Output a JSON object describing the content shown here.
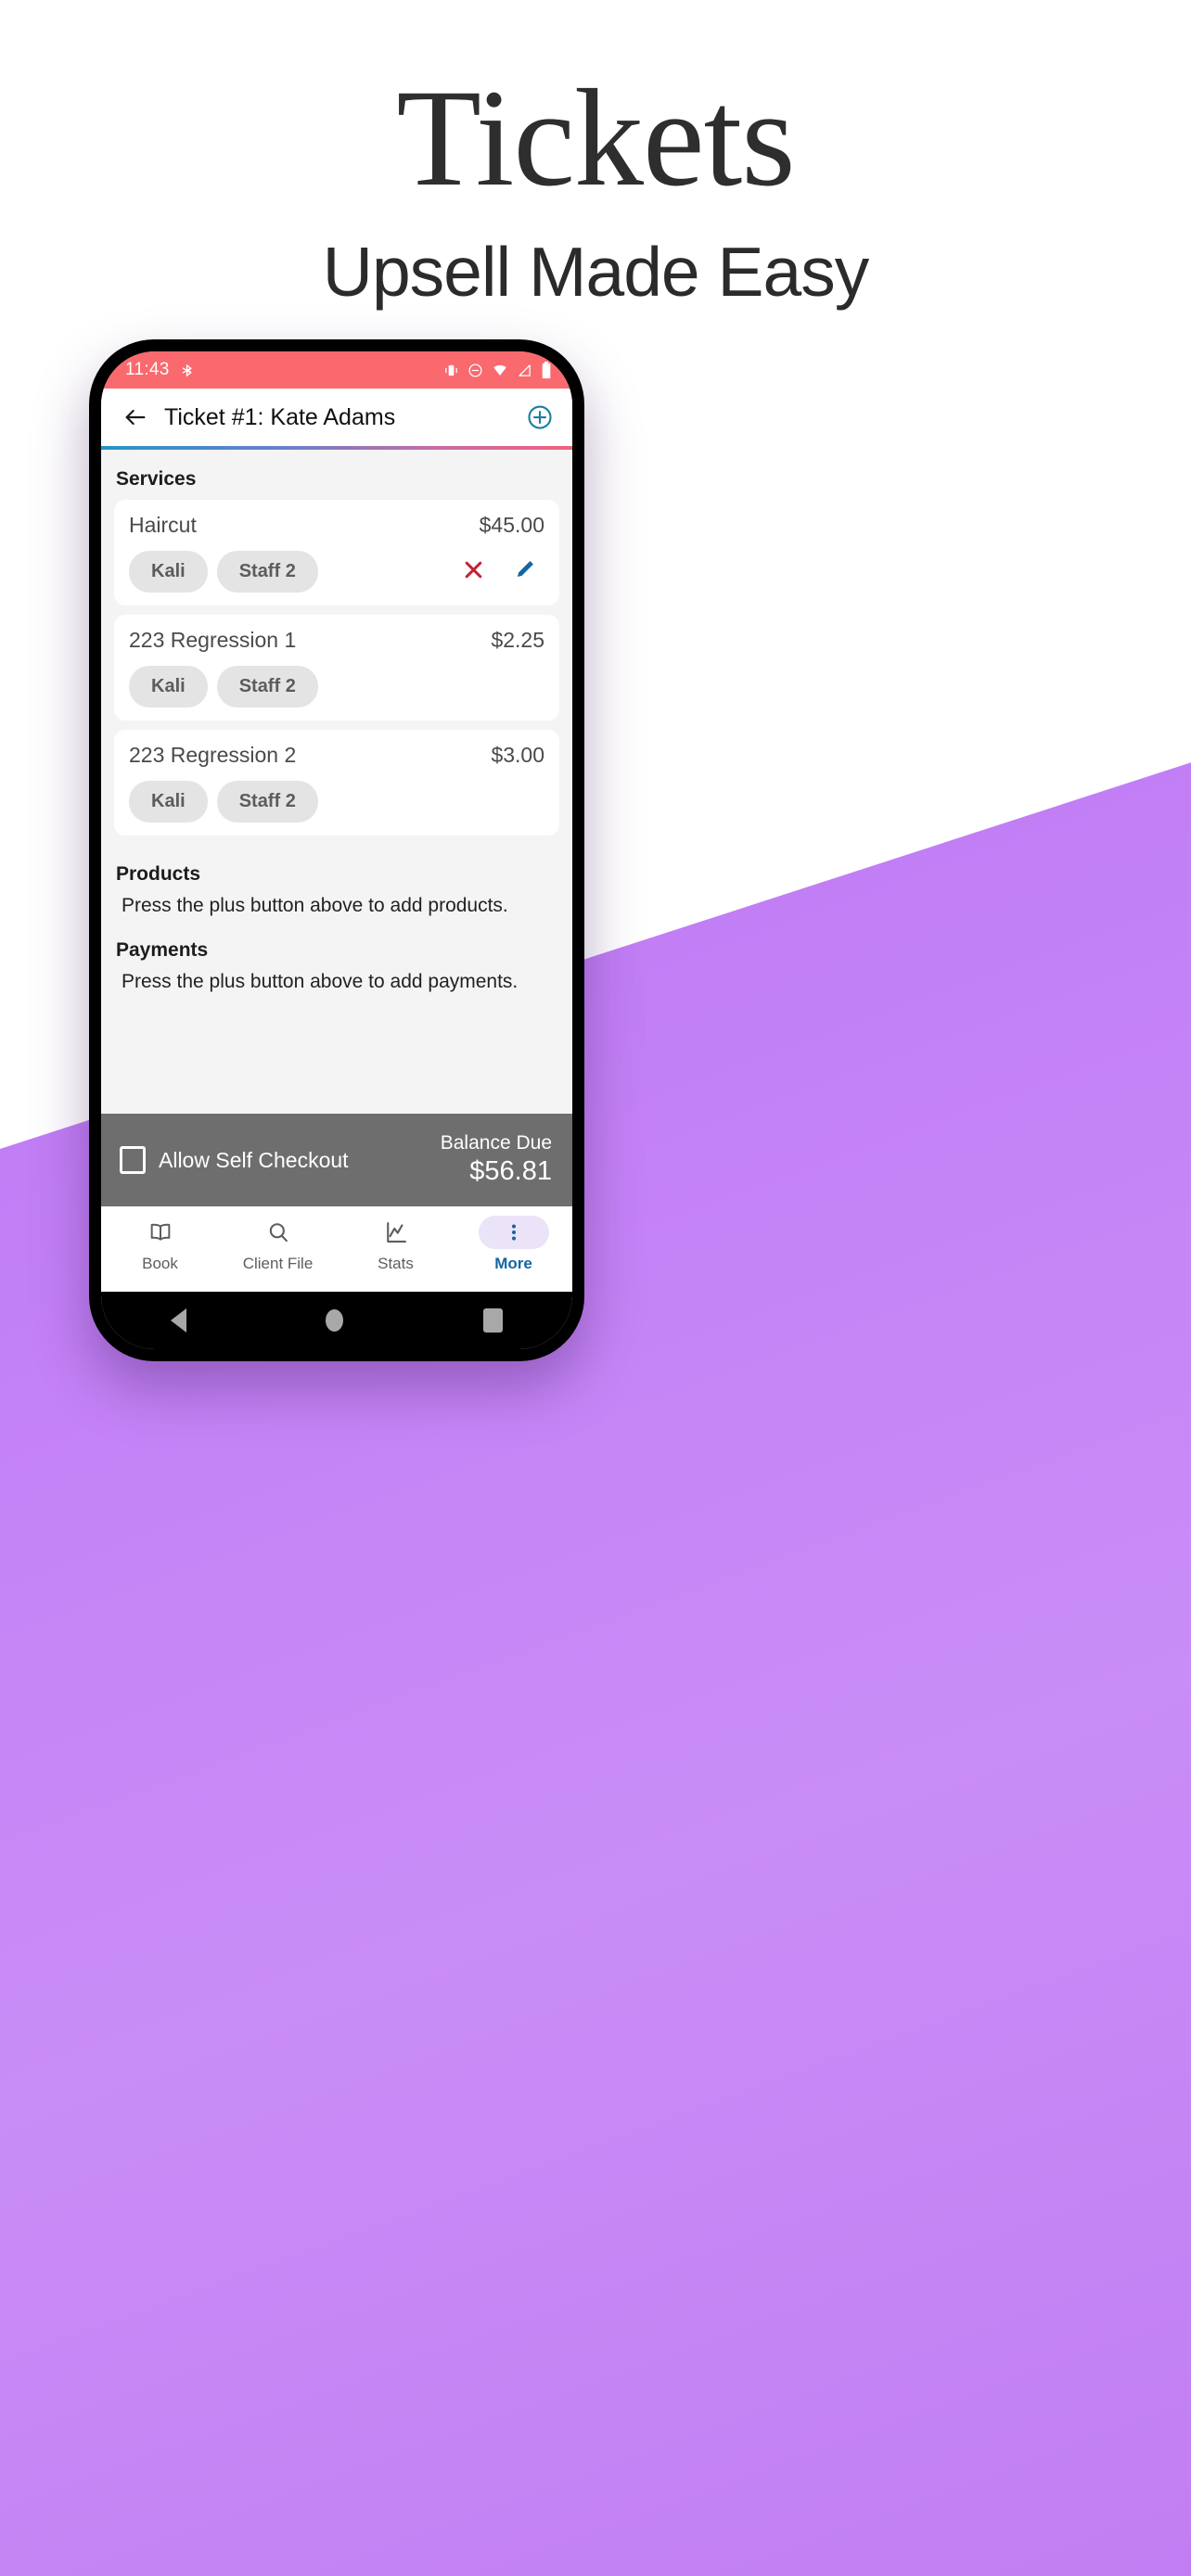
{
  "hero": {
    "title": "Tickets",
    "subtitle": "Upsell Made Easy"
  },
  "colors": {
    "purple_background": "#c07cf5",
    "status_bar": "#f9696e",
    "accent_teal": "#1a7fa0",
    "delete_red": "#c32033",
    "edit_blue": "#1565a0",
    "balance_bar": "#6e6e6e",
    "nav_active_pill": "#ebe3f7"
  },
  "phone": {
    "status_bar": {
      "time": "11:43",
      "left_icons": [
        "bluetooth-icon"
      ],
      "right_icons": [
        "vibrate-icon",
        "do-not-disturb-icon",
        "wifi-icon",
        "signal-icon",
        "battery-icon"
      ]
    },
    "app_bar": {
      "back_icon": "back-arrow-icon",
      "title": "Ticket #1: Kate Adams",
      "add_icon": "add-circle-icon"
    },
    "services": {
      "heading": "Services",
      "items": [
        {
          "name": "Haircut",
          "price": "$45.00",
          "staff": [
            "Kali",
            "Staff 2"
          ],
          "actions": [
            "delete-icon",
            "edit-icon"
          ]
        },
        {
          "name": "223 Regression 1",
          "price": "$2.25",
          "staff": [
            "Kali",
            "Staff 2"
          ],
          "actions": []
        },
        {
          "name": "223 Regression 2",
          "price": "$3.00",
          "staff": [
            "Kali",
            "Staff 2"
          ],
          "actions": []
        }
      ]
    },
    "products": {
      "heading": "Products",
      "empty_message": "Press the plus button above to add products."
    },
    "payments": {
      "heading": "Payments",
      "empty_message": "Press the plus button above to add payments."
    },
    "balance_bar": {
      "checkbox_label": "Allow Self Checkout",
      "checkbox_checked": false,
      "balance_label": "Balance Due",
      "balance_amount": "$56.81"
    },
    "bottom_nav": {
      "items": [
        {
          "label": "Book",
          "icon": "book-icon",
          "active": false
        },
        {
          "label": "Client File",
          "icon": "search-icon",
          "active": false
        },
        {
          "label": "Stats",
          "icon": "chart-icon",
          "active": false
        },
        {
          "label": "More",
          "icon": "more-vertical-icon",
          "active": true
        }
      ]
    },
    "android_nav": {
      "buttons": [
        "back-triangle-icon",
        "home-circle-icon",
        "recents-square-icon"
      ]
    }
  }
}
